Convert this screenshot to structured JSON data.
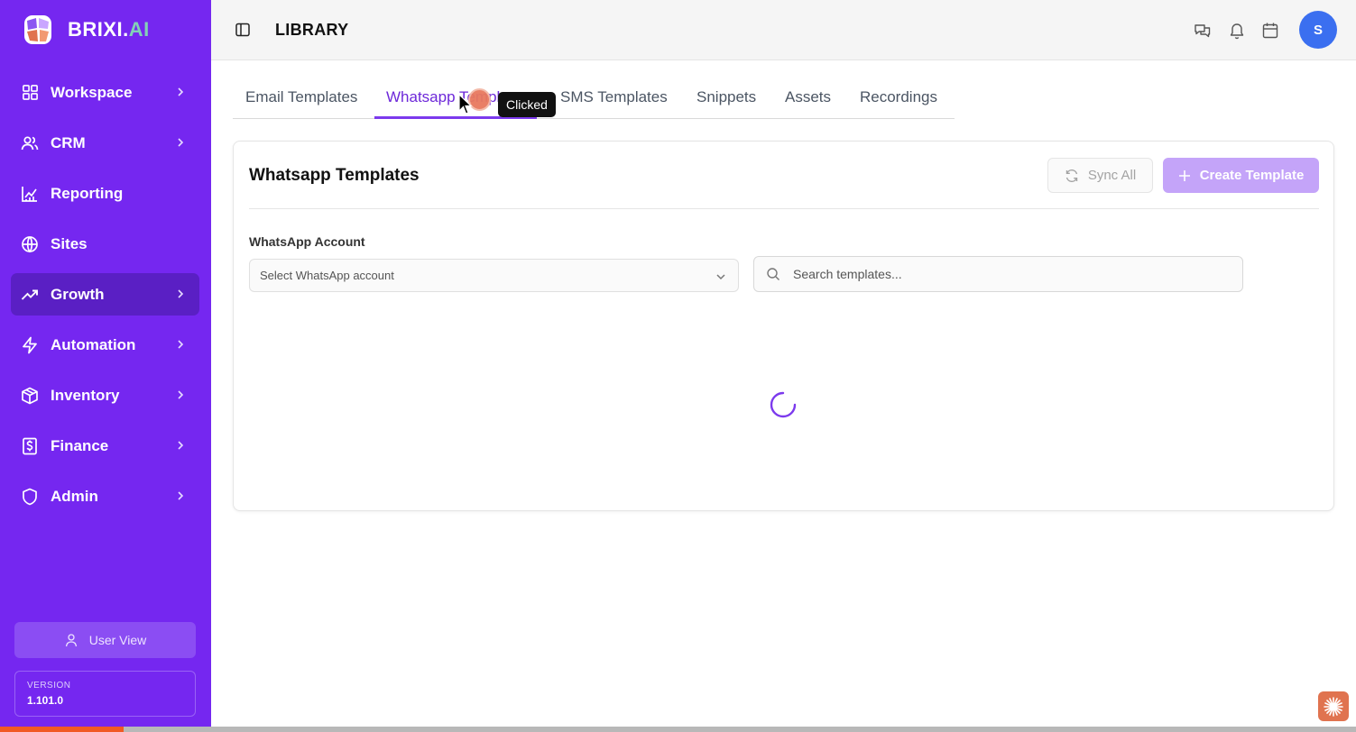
{
  "app": {
    "brand": "BRIXI.",
    "brand_suffix": "AI",
    "accent_color": "#7527f0"
  },
  "sidebar": {
    "items": [
      {
        "label": "Workspace",
        "icon": "grid-icon",
        "has_chevron": true
      },
      {
        "label": "CRM",
        "icon": "users-icon",
        "has_chevron": true
      },
      {
        "label": "Reporting",
        "icon": "chart-icon",
        "has_chevron": false
      },
      {
        "label": "Sites",
        "icon": "globe-icon",
        "has_chevron": false
      },
      {
        "label": "Growth",
        "icon": "trending-up-icon",
        "has_chevron": true,
        "active": true
      },
      {
        "label": "Automation",
        "icon": "zap-icon",
        "has_chevron": true
      },
      {
        "label": "Inventory",
        "icon": "box-icon",
        "has_chevron": true
      },
      {
        "label": "Finance",
        "icon": "dollar-icon",
        "has_chevron": true
      },
      {
        "label": "Admin",
        "icon": "shield-icon",
        "has_chevron": true
      }
    ],
    "user_view_label": "User View",
    "version_label": "VERSION",
    "version_value": "1.101.0"
  },
  "header": {
    "title": "LIBRARY",
    "avatar_initial": "S"
  },
  "tabs": [
    {
      "label": "Email Templates"
    },
    {
      "label": "Whatsapp Templates",
      "active": true
    },
    {
      "label": "SMS Templates"
    },
    {
      "label": "Snippets"
    },
    {
      "label": "Assets"
    },
    {
      "label": "Recordings"
    }
  ],
  "tooltip": "Clicked",
  "card": {
    "title": "Whatsapp Templates",
    "sync_label": "Sync All",
    "create_label": "Create Template",
    "account_label": "WhatsApp Account",
    "account_select_value": "Select WhatsApp account",
    "search_placeholder": "Search templates..."
  }
}
